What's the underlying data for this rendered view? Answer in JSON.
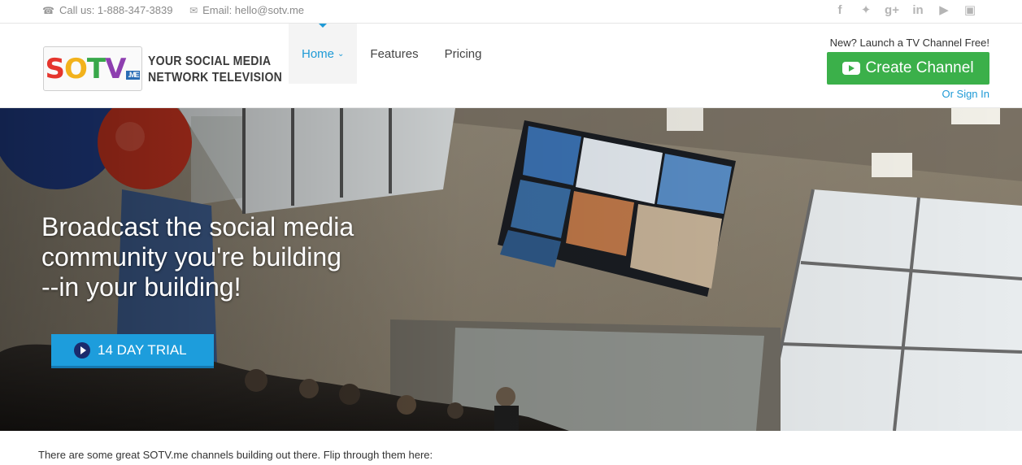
{
  "topbar": {
    "phone": "Call us: 1-888-347-3839",
    "email": "Email: hello@sotv.me",
    "socials": [
      "facebook-icon",
      "twitter-icon",
      "google-plus-icon",
      "linkedin-icon",
      "youtube-icon",
      "instagram-icon"
    ]
  },
  "logo": {
    "letters": [
      "S",
      "O",
      "T",
      "V"
    ],
    "suffix": ".ME",
    "tagline_line1": "YOUR SOCIAL MEDIA",
    "tagline_line2": "NETWORK TELEVISION"
  },
  "nav": {
    "items": [
      {
        "label": "Home",
        "active": true
      },
      {
        "label": "Features",
        "active": false
      },
      {
        "label": "Pricing",
        "active": false
      }
    ]
  },
  "cta": {
    "note": "New? Launch a TV Channel Free!",
    "button": "Create Channel",
    "signin": "Or Sign In"
  },
  "hero": {
    "line1": "Broadcast the social media",
    "line2": "community you're building",
    "line3": "--in your building!",
    "trial_button": "14 DAY TRIAL"
  },
  "footer_text": "There are some great SOTV.me channels building out there. Flip through them here:",
  "colors": {
    "accent_blue": "#1e9ad6",
    "cta_green": "#3bb04a",
    "trial_blue": "#1d9ddc"
  }
}
